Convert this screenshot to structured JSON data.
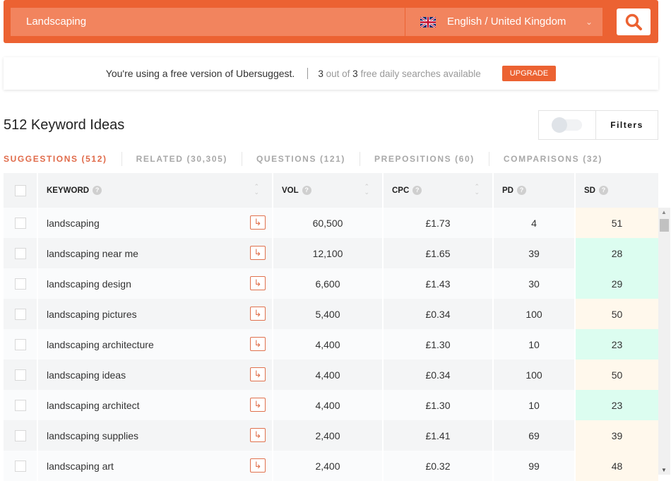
{
  "search": {
    "query": "Landscaping",
    "language": "English / United Kingdom",
    "language_flag": "uk-flag-icon",
    "search_icon": "search-icon"
  },
  "notice": {
    "message": "You're using a free version of Ubersuggest.",
    "searches_used": "3",
    "out_of": "out of",
    "searches_total": "3",
    "suffix": "free daily searches available",
    "upgrade_label": "UPGRADE"
  },
  "page": {
    "title": "512 Keyword Ideas",
    "filters_label": "Filters",
    "toggle_on": false
  },
  "tabs": [
    {
      "label": "SUGGESTIONS (512)",
      "active": true
    },
    {
      "label": "RELATED (30,305)",
      "active": false
    },
    {
      "label": "QUESTIONS (121)",
      "active": false
    },
    {
      "label": "PREPOSITIONS (60)",
      "active": false
    },
    {
      "label": "COMPARISONS (32)",
      "active": false
    }
  ],
  "table": {
    "columns": {
      "keyword": "KEYWORD",
      "vol": "VOL",
      "cpc": "CPC",
      "pd": "PD",
      "sd": "SD"
    },
    "rows": [
      {
        "keyword": "landscaping",
        "vol": "60,500",
        "cpc": "£1.73",
        "pd": "4",
        "sd": "51",
        "sd_level": "med"
      },
      {
        "keyword": "landscaping near me",
        "vol": "12,100",
        "cpc": "£1.65",
        "pd": "39",
        "sd": "28",
        "sd_level": "easy"
      },
      {
        "keyword": "landscaping design",
        "vol": "6,600",
        "cpc": "£1.43",
        "pd": "30",
        "sd": "29",
        "sd_level": "easy"
      },
      {
        "keyword": "landscaping pictures",
        "vol": "5,400",
        "cpc": "£0.34",
        "pd": "100",
        "sd": "50",
        "sd_level": "med"
      },
      {
        "keyword": "landscaping architecture",
        "vol": "4,400",
        "cpc": "£1.30",
        "pd": "10",
        "sd": "23",
        "sd_level": "easy"
      },
      {
        "keyword": "landscaping ideas",
        "vol": "4,400",
        "cpc": "£0.34",
        "pd": "100",
        "sd": "50",
        "sd_level": "med"
      },
      {
        "keyword": "landscaping architect",
        "vol": "4,400",
        "cpc": "£1.30",
        "pd": "10",
        "sd": "23",
        "sd_level": "easy"
      },
      {
        "keyword": "landscaping supplies",
        "vol": "2,400",
        "cpc": "£1.41",
        "pd": "69",
        "sd": "39",
        "sd_level": "med"
      },
      {
        "keyword": "landscaping art",
        "vol": "2,400",
        "cpc": "£0.32",
        "pd": "99",
        "sd": "48",
        "sd_level": "med"
      }
    ]
  },
  "colors": {
    "brand": "#ec6232",
    "sd_easy": "#dcfdf0",
    "sd_medium": "#fff8ec",
    "tab_active": "#e06a49"
  }
}
